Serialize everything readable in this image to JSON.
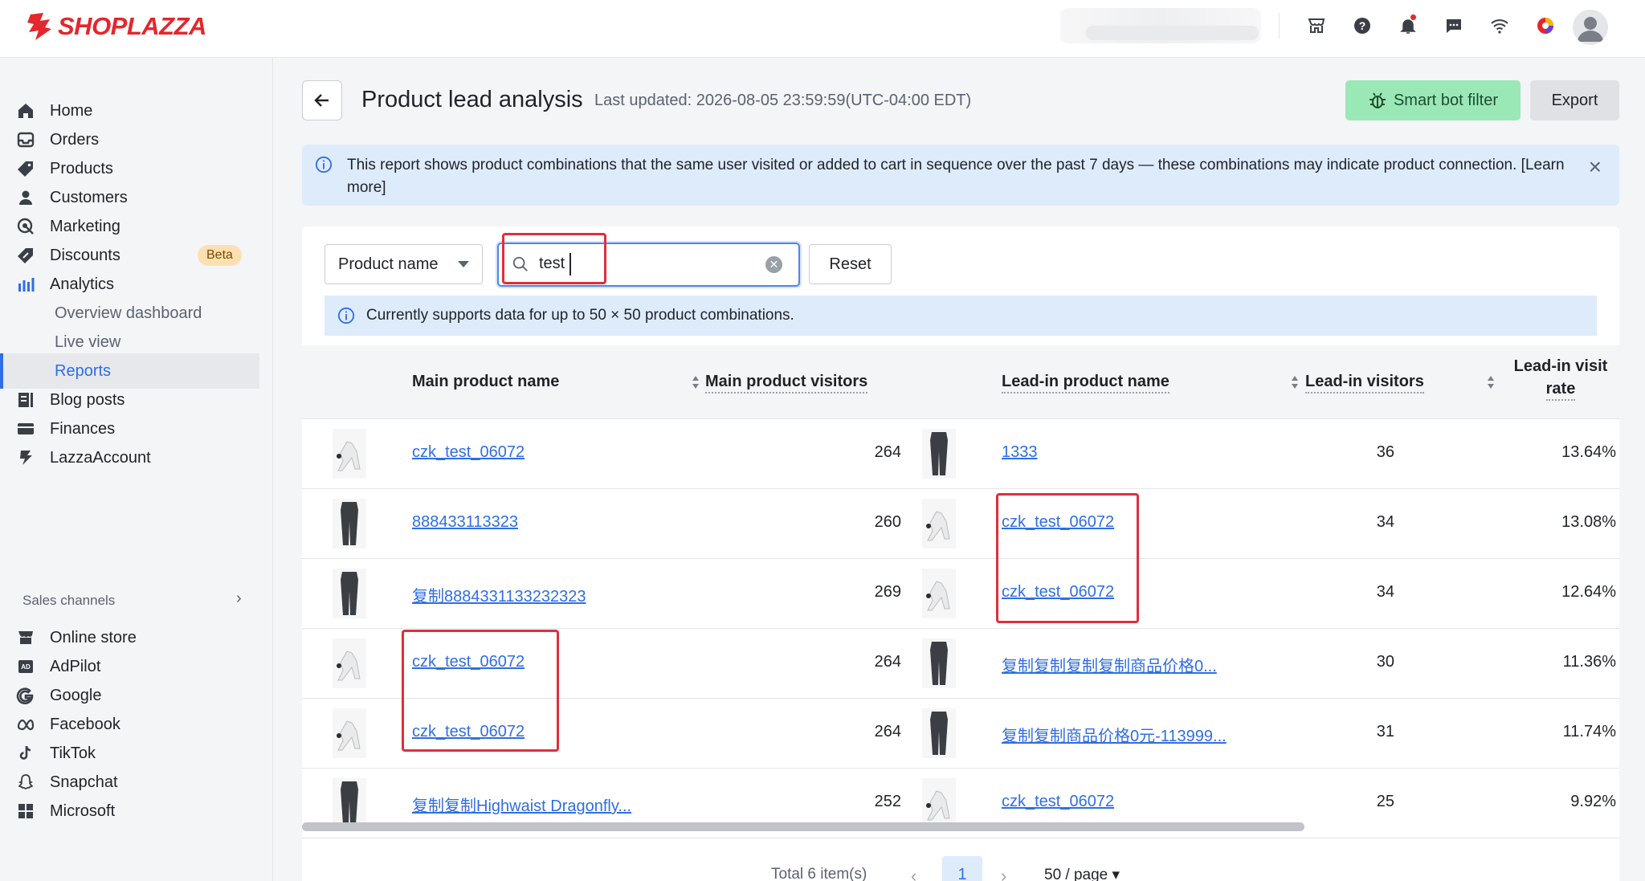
{
  "brand": {
    "name": "SHOPLAZZA",
    "color": "#e5262c"
  },
  "topbar": {
    "icons": [
      "store-icon",
      "help-icon",
      "bell-icon",
      "chat-icon",
      "wifi-icon",
      "apps-icon"
    ]
  },
  "sidebar": {
    "items": [
      {
        "label": "Home",
        "icon": "home-icon"
      },
      {
        "label": "Orders",
        "icon": "orders-icon"
      },
      {
        "label": "Products",
        "icon": "tag-icon"
      },
      {
        "label": "Customers",
        "icon": "person-icon"
      },
      {
        "label": "Marketing",
        "icon": "marketing-icon"
      },
      {
        "label": "Discounts",
        "icon": "discount-icon",
        "badge": "Beta"
      },
      {
        "label": "Analytics",
        "icon": "bar-chart-icon"
      }
    ],
    "analytics_sub": [
      "Overview dashboard",
      "Live view",
      "Reports"
    ],
    "more_items": [
      {
        "label": "Blog posts",
        "icon": "blog-icon"
      },
      {
        "label": "Finances",
        "icon": "finance-icon"
      },
      {
        "label": "LazzaAccount",
        "icon": "lazza-icon"
      }
    ],
    "sales_channels_label": "Sales channels",
    "channels": [
      {
        "label": "Online store",
        "icon": "store-icon"
      },
      {
        "label": "AdPilot",
        "icon": "ad-icon"
      },
      {
        "label": "Google",
        "icon": "google-icon"
      },
      {
        "label": "Facebook",
        "icon": "meta-icon"
      },
      {
        "label": "TikTok",
        "icon": "tiktok-icon"
      },
      {
        "label": "Snapchat",
        "icon": "snapchat-icon"
      },
      {
        "label": "Microsoft",
        "icon": "microsoft-icon"
      }
    ]
  },
  "header": {
    "title": "Product lead analysis",
    "last_updated": "Last updated: 2026-08-05 23:59:59(UTC-04:00 EDT)",
    "smart_bot_filter": "Smart bot filter",
    "export": "Export"
  },
  "banner": {
    "text": "This report shows product combinations that the same user visited or added to cart in sequence over the past 7 days — these combinations may indicate product connection. [Learn more]"
  },
  "filters": {
    "field": "Product name",
    "search_value": "test",
    "reset": "Reset",
    "note": "Currently supports data for up to 50 × 50 product combinations."
  },
  "table": {
    "columns": {
      "main_name": "Main product name",
      "main_visitors": "Main product visitors",
      "lead_name": "Lead-in product name",
      "lead_visitors": "Lead-in visitors",
      "lead_rate_1": "Lead-in visit",
      "lead_rate_2": "rate"
    },
    "rows": [
      {
        "main_img": "white",
        "main_name": "czk_test_06072",
        "main_visitors": "264",
        "lead_img": "dark",
        "lead_name": "1333",
        "lead_visitors": "36",
        "rate": "13.64%"
      },
      {
        "main_img": "dark",
        "main_name": "888433113323",
        "main_visitors": "260",
        "lead_img": "white",
        "lead_name": "czk_test_06072",
        "lead_visitors": "34",
        "rate": "13.08%"
      },
      {
        "main_img": "dark",
        "main_name": "复制8884331133232323",
        "main_visitors": "269",
        "lead_img": "white",
        "lead_name": "czk_test_06072",
        "lead_visitors": "34",
        "rate": "12.64%"
      },
      {
        "main_img": "white",
        "main_name": "czk_test_06072",
        "main_visitors": "264",
        "lead_img": "dark",
        "lead_name": "复制复制复制复制商品价格0...",
        "lead_visitors": "30",
        "rate": "11.36%"
      },
      {
        "main_img": "white",
        "main_name": "czk_test_06072",
        "main_visitors": "264",
        "lead_img": "dark",
        "lead_name": "复制复制商品价格0元-113999...",
        "lead_visitors": "31",
        "rate": "11.74%"
      },
      {
        "main_img": "dark",
        "main_name": "复制复制Highwaist Dragonfly...",
        "main_visitors": "252",
        "lead_img": "white",
        "lead_name": "czk_test_06072",
        "lead_visitors": "25",
        "rate": "9.92%"
      }
    ]
  },
  "pagination": {
    "total": "Total 6 item(s)",
    "current": "1",
    "page_size": "50 / page"
  }
}
